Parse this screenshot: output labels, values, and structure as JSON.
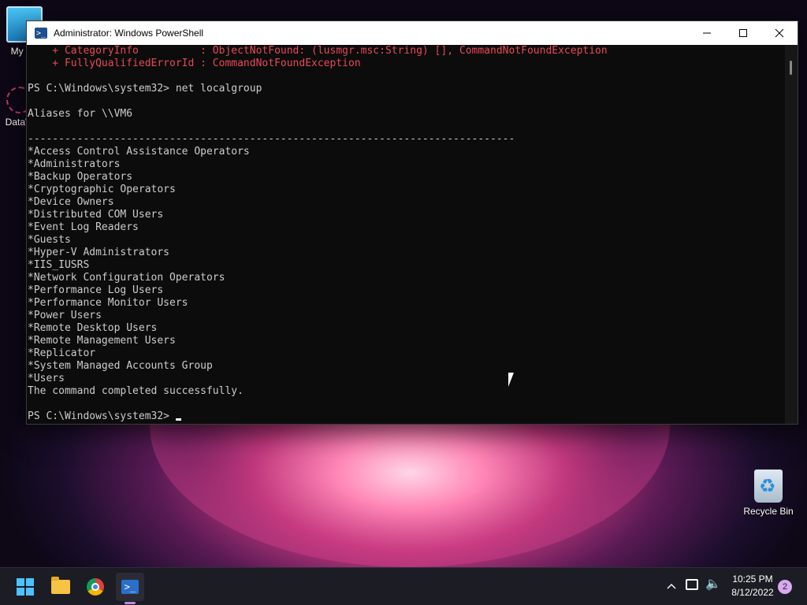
{
  "window": {
    "title": "Administrator: Windows PowerShell",
    "minimize_icon": "minimize-icon",
    "maximize_icon": "maximize-icon",
    "close_icon": "close-icon"
  },
  "console": {
    "lines": [
      {
        "text": "    + CategoryInfo          : ObjectNotFound: (lusmgr.msc:String) [], CommandNotFoundException",
        "style": "err"
      },
      {
        "text": "    + FullyQualifiedErrorId : CommandNotFoundException",
        "style": "err"
      },
      {
        "text": "",
        "style": ""
      },
      {
        "text": "PS C:\\Windows\\system32> net localgroup",
        "style": ""
      },
      {
        "text": "",
        "style": ""
      },
      {
        "text": "Aliases for \\\\VM6",
        "style": ""
      },
      {
        "text": "",
        "style": ""
      },
      {
        "text": "-------------------------------------------------------------------------------",
        "style": ""
      },
      {
        "text": "*Access Control Assistance Operators",
        "style": ""
      },
      {
        "text": "*Administrators",
        "style": ""
      },
      {
        "text": "*Backup Operators",
        "style": ""
      },
      {
        "text": "*Cryptographic Operators",
        "style": ""
      },
      {
        "text": "*Device Owners",
        "style": ""
      },
      {
        "text": "*Distributed COM Users",
        "style": ""
      },
      {
        "text": "*Event Log Readers",
        "style": ""
      },
      {
        "text": "*Guests",
        "style": ""
      },
      {
        "text": "*Hyper-V Administrators",
        "style": ""
      },
      {
        "text": "*IIS_IUSRS",
        "style": ""
      },
      {
        "text": "*Network Configuration Operators",
        "style": ""
      },
      {
        "text": "*Performance Log Users",
        "style": ""
      },
      {
        "text": "*Performance Monitor Users",
        "style": ""
      },
      {
        "text": "*Power Users",
        "style": ""
      },
      {
        "text": "*Remote Desktop Users",
        "style": ""
      },
      {
        "text": "*Remote Management Users",
        "style": ""
      },
      {
        "text": "*Replicator",
        "style": ""
      },
      {
        "text": "*System Managed Accounts Group",
        "style": ""
      },
      {
        "text": "*Users",
        "style": ""
      },
      {
        "text": "The command completed successfully.",
        "style": ""
      },
      {
        "text": "",
        "style": ""
      }
    ],
    "prompt": "PS C:\\Windows\\system32> "
  },
  "desktop": {
    "icons": [
      {
        "label": "My Co",
        "icon": "computer-icon"
      },
      {
        "label": "DataW",
        "icon": "app-shortcut-icon"
      },
      {
        "label": "Recycle Bin",
        "icon": "recycle-bin-icon"
      }
    ]
  },
  "taskbar": {
    "apps": [
      {
        "name": "Start",
        "icon": "windows-start-icon"
      },
      {
        "name": "File Explorer",
        "icon": "folder-icon"
      },
      {
        "name": "Google Chrome",
        "icon": "chrome-icon"
      },
      {
        "name": "Windows PowerShell",
        "icon": "powershell-icon"
      }
    ],
    "tray": {
      "chevron": "^",
      "time": "10:25 PM",
      "date": "8/12/2022",
      "notification_count": "2"
    }
  },
  "colors": {
    "console_bg": "#0c0c0c",
    "console_fg": "#cccccc",
    "error_fg": "#e74856",
    "accent": "#4cc2ff"
  }
}
